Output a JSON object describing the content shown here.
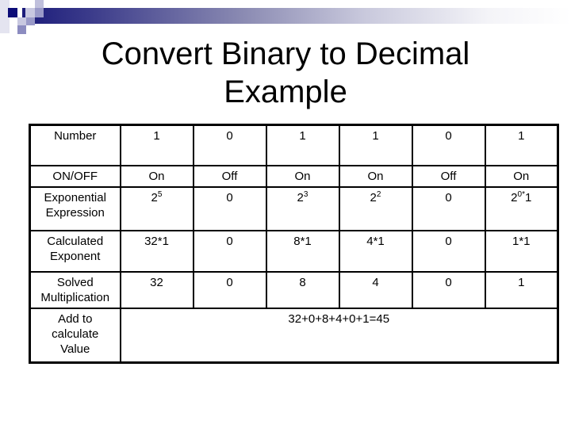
{
  "slide": {
    "title_line1": "Convert Binary to Decimal",
    "title_line2": "Example",
    "accent_colors": [
      "#1b1b7a",
      "#8a8ab2",
      "#c8c8dc"
    ]
  },
  "table": {
    "rows": [
      {
        "label": "Number",
        "cells": [
          "1",
          "0",
          "1",
          "1",
          "0",
          "1"
        ]
      },
      {
        "label": "ON/OFF",
        "cells": [
          "On",
          "Off",
          "On",
          "On",
          "Off",
          "On"
        ]
      },
      {
        "label_line1": "Exponential",
        "label_line2": "Expression",
        "cells": [
          {
            "base": "2",
            "exp": "5",
            "rest": ""
          },
          {
            "base": "0",
            "exp": "",
            "rest": ""
          },
          {
            "base": "2",
            "exp": "3",
            "rest": ""
          },
          {
            "base": "2",
            "exp": "2",
            "rest": ""
          },
          {
            "base": "0",
            "exp": "",
            "rest": ""
          },
          {
            "base": "2",
            "exp": "0*",
            "rest": "1"
          }
        ]
      },
      {
        "label_line1": "Calculated",
        "label_line2": "Exponent",
        "cells": [
          "32*1",
          "0",
          "8*1",
          "4*1",
          "0",
          "1*1"
        ]
      },
      {
        "label_line1": "Solved",
        "label_line2": "Multiplication",
        "cells": [
          "32",
          "0",
          "8",
          "4",
          "0",
          "1"
        ]
      },
      {
        "label_line1": "Add to",
        "label_line2": "calculate",
        "label_line3": "Value",
        "sum": "32+0+8+4+0+1=45"
      }
    ]
  }
}
